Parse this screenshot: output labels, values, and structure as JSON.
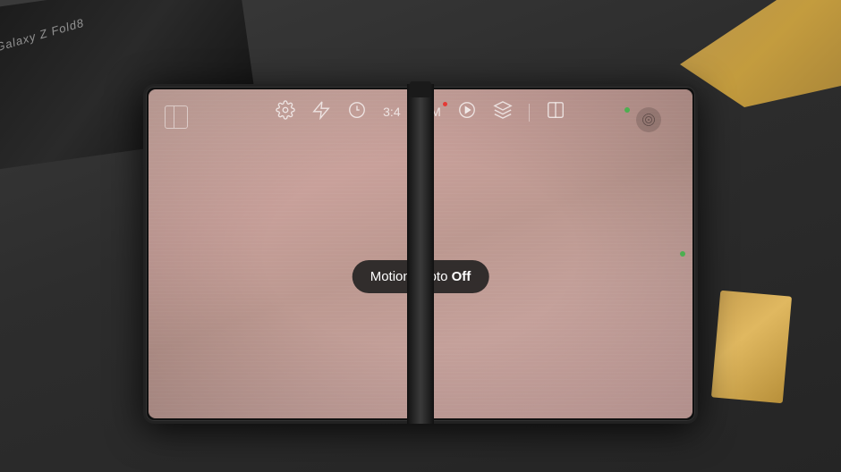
{
  "scene": {
    "bg_color": "#2d2d2d"
  },
  "phone_box": {
    "brand_text": "Galaxy Z Fold8"
  },
  "toolbar": {
    "ratio_label": "3:4",
    "megapixels_label": "12M",
    "icons": [
      "settings",
      "flash",
      "timer",
      "ratio",
      "megapixels",
      "motion_photo",
      "layers",
      "divider",
      "layout"
    ]
  },
  "motion_tooltip": {
    "text_prefix": "Motion photo ",
    "text_suffix": "Off"
  },
  "indicators": {
    "green_dot_color": "#4CAF50",
    "red_dot_color": "#e53935"
  }
}
